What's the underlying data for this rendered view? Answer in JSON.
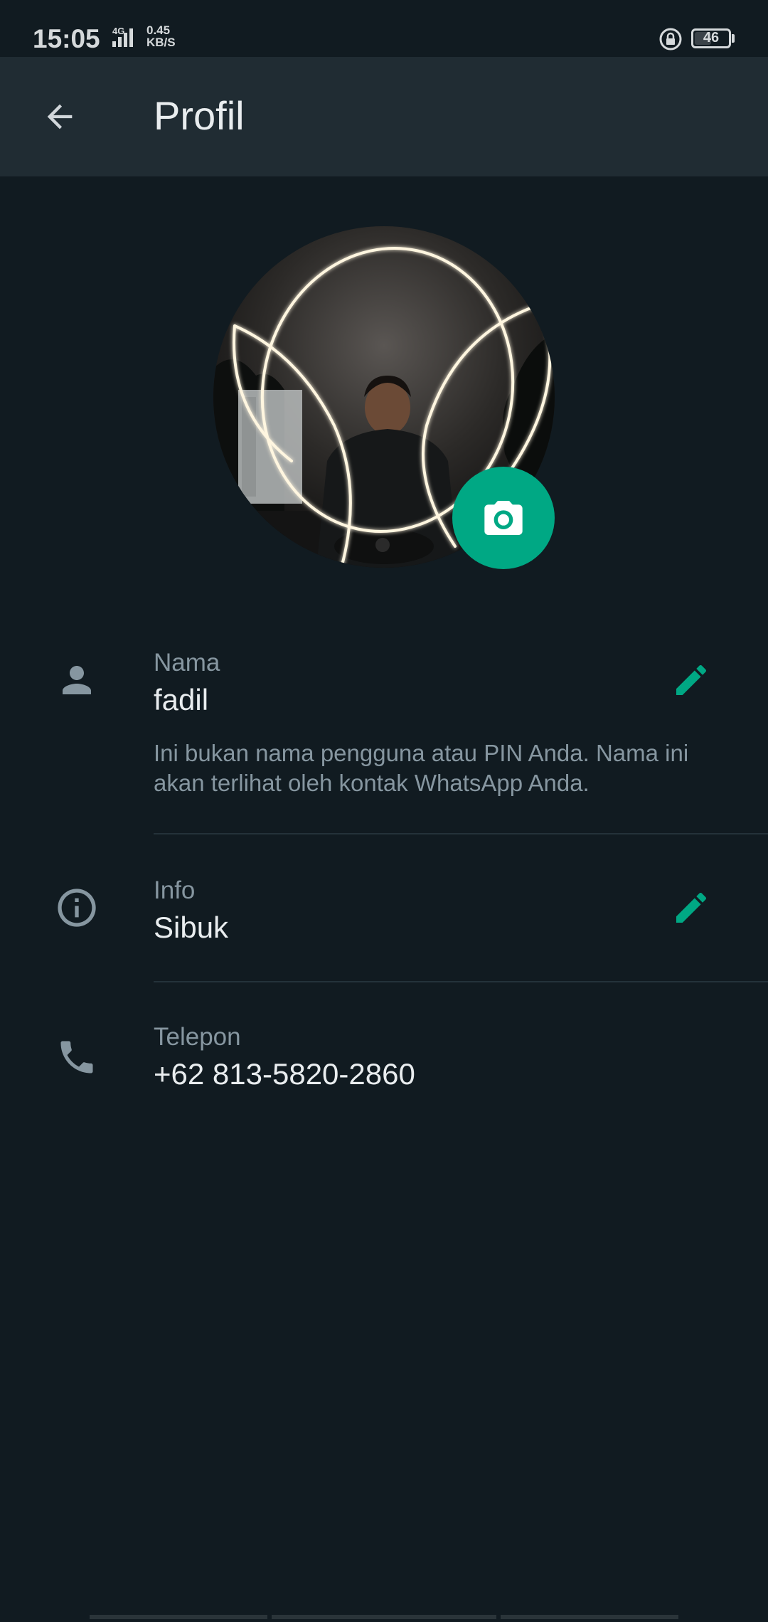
{
  "status_bar": {
    "time": "15:05",
    "network": "4G",
    "speed_value": "0.45",
    "speed_unit": "KB/S",
    "battery": "46"
  },
  "app_bar": {
    "title": "Profil",
    "back_icon": "arrow-left-icon"
  },
  "profile": {
    "avatar_icon": "profile-photo",
    "camera_icon": "camera-icon"
  },
  "fields": {
    "name": {
      "icon": "person-icon",
      "label": "Nama",
      "value": "fadil",
      "hint": "Ini bukan nama pengguna atau PIN Anda. Nama ini akan terlihat oleh kontak WhatsApp Anda.",
      "edit_icon": "pencil-icon"
    },
    "info": {
      "icon": "info-icon",
      "label": "Info",
      "value": "Sibuk",
      "edit_icon": "pencil-icon"
    },
    "phone": {
      "icon": "phone-icon",
      "label": "Telepon",
      "value": "+62 813-5820-2860"
    }
  },
  "colors": {
    "background": "#111b21",
    "app_bar": "#202c33",
    "accent": "#00a884",
    "secondary_text": "#8696a0",
    "primary_text": "#e9edef"
  }
}
